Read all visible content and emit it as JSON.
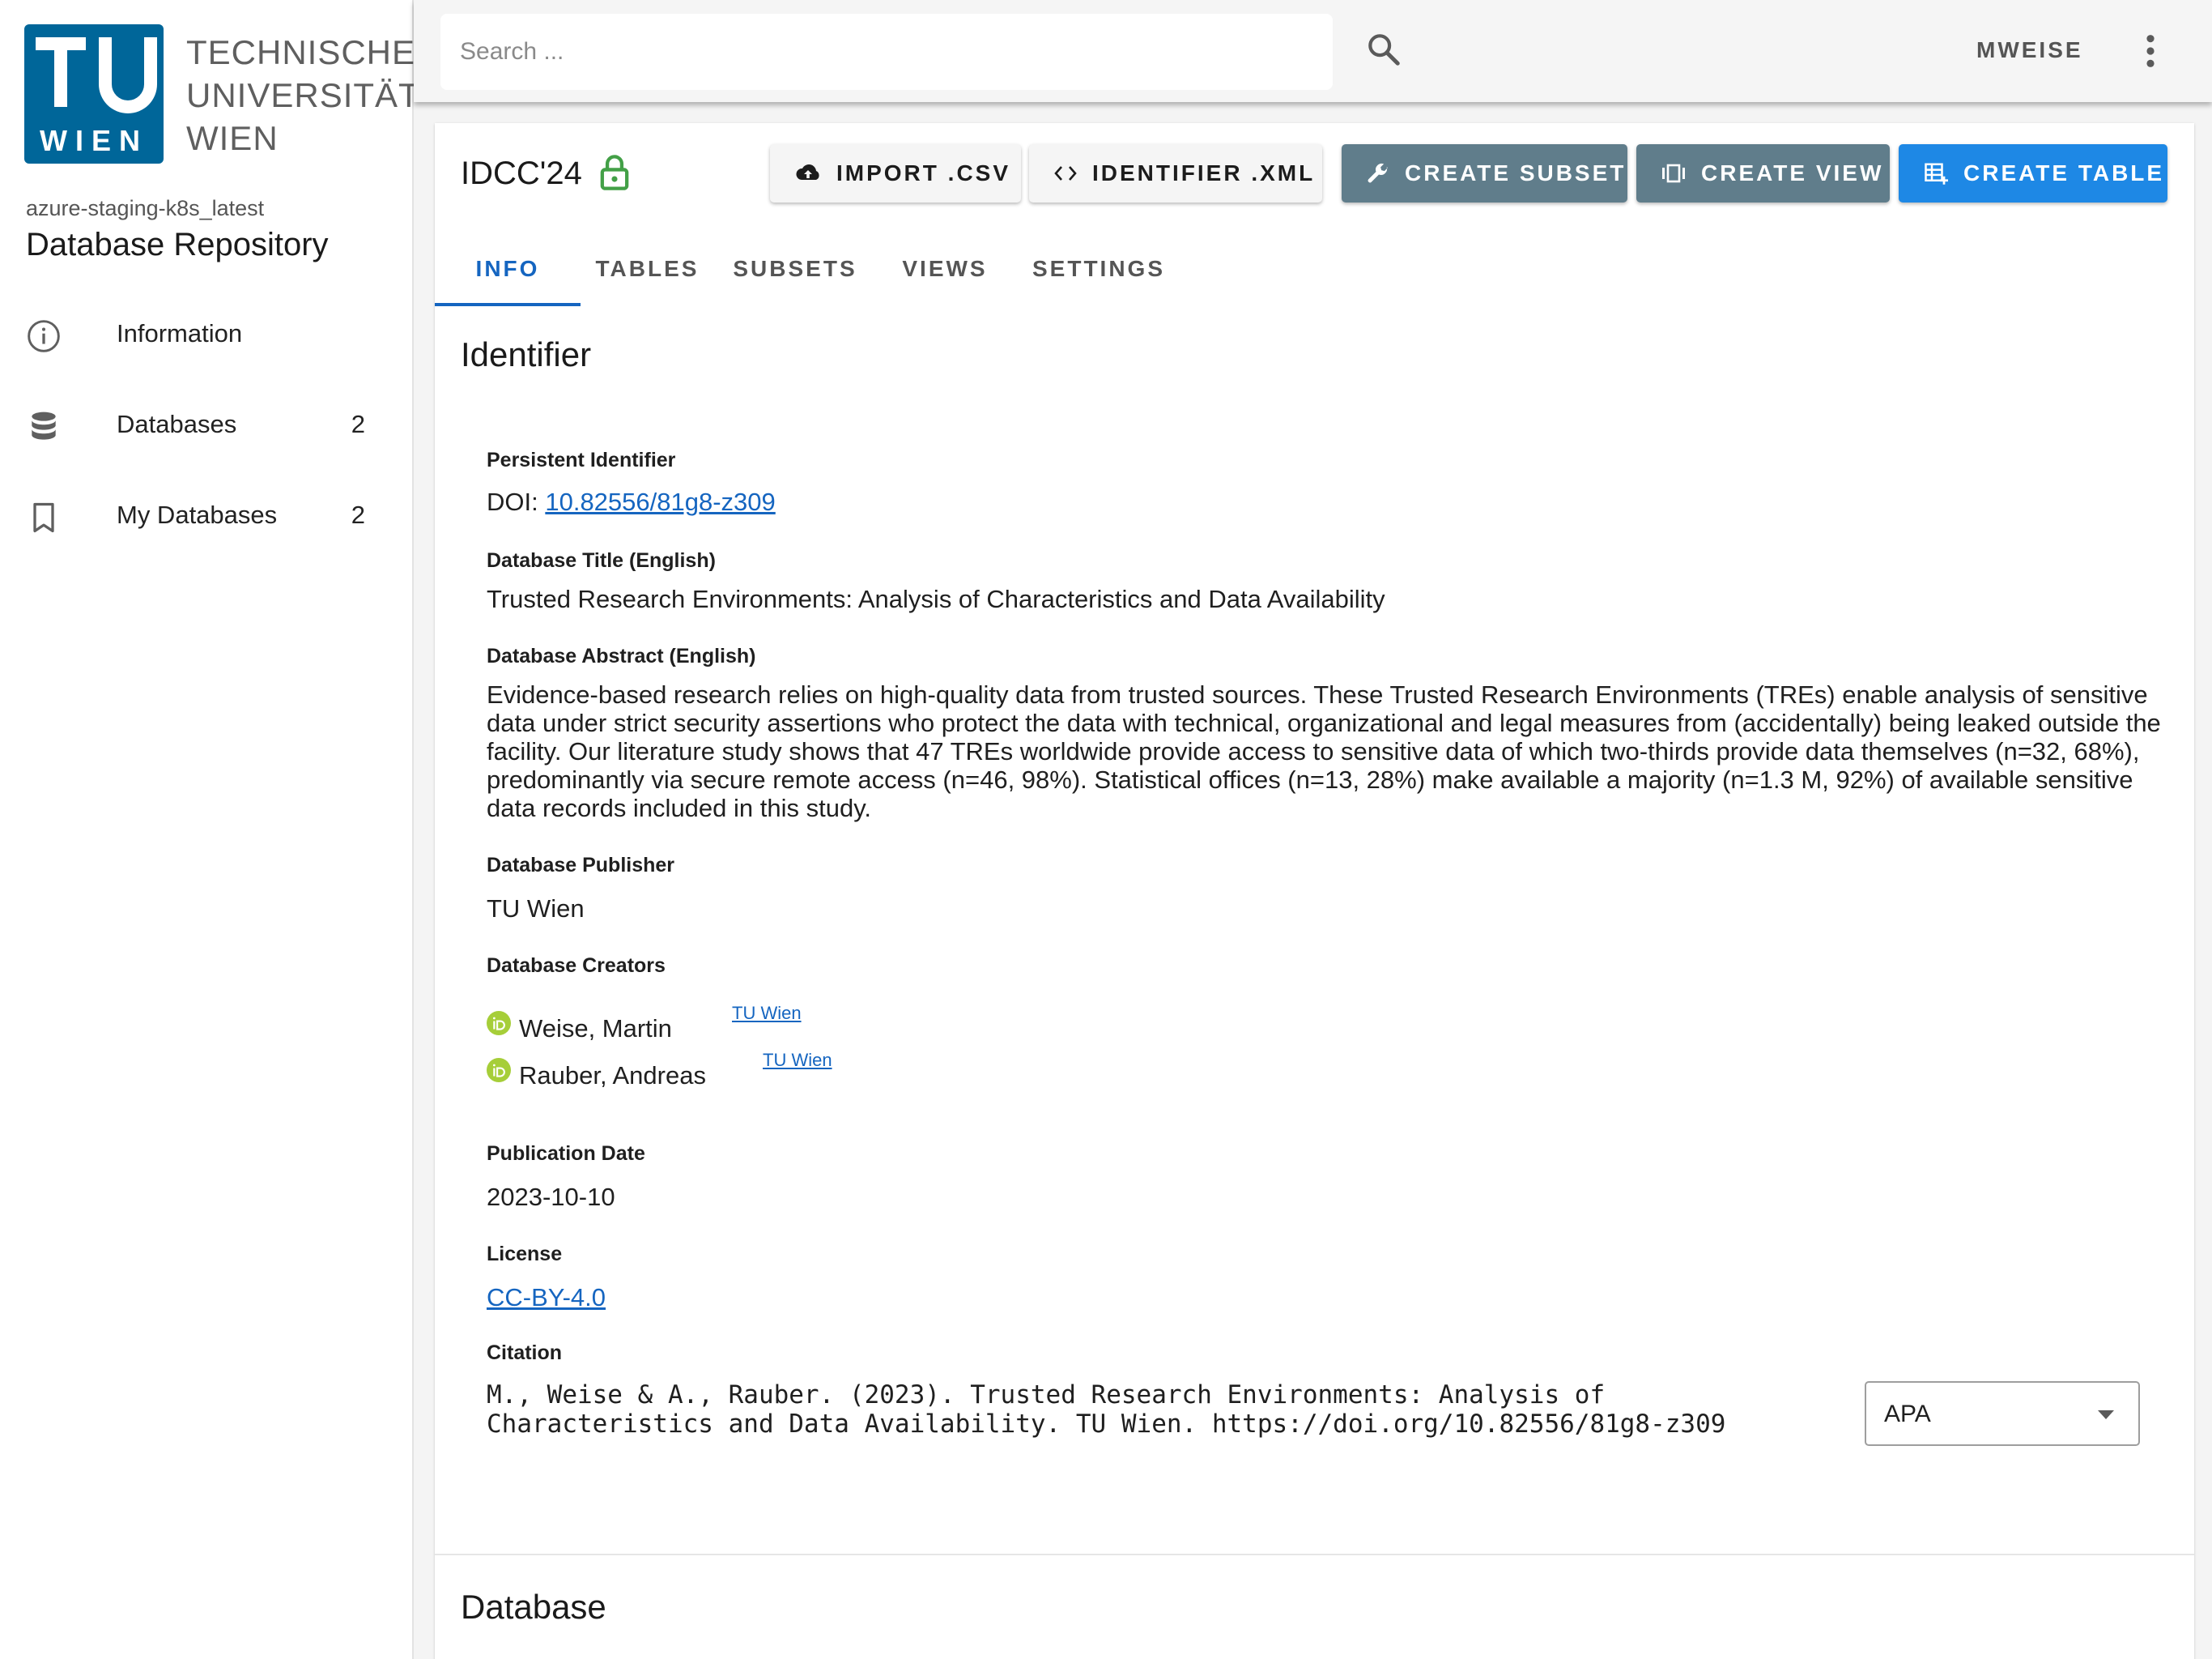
{
  "sidebar": {
    "logo": {
      "line1": "TECHNISCHE",
      "line2": "UNIVERSITÄT",
      "line3": "WIEN",
      "mark_text": "TU WIEN",
      "mark_color": "#006699"
    },
    "environment": "azure-staging-k8s_latest",
    "app_title": "Database Repository",
    "items": [
      {
        "label": "Information",
        "icon": "info-circle-icon",
        "count": ""
      },
      {
        "label": "Databases",
        "icon": "database-icon",
        "count": "2"
      },
      {
        "label": "My Databases",
        "icon": "bookmark-icon",
        "count": "2"
      }
    ]
  },
  "topbar": {
    "search_placeholder": "Search ...",
    "search_value": "",
    "user_label": "MWEISE"
  },
  "database": {
    "title": "IDCC'24",
    "access_icon": "lock-open-icon",
    "accent_color": "#1e88e5",
    "actions": {
      "import_csv": "IMPORT .CSV",
      "identifier_xml": "IDENTIFIER .XML",
      "create_subset": "CREATE SUBSET",
      "create_view": "CREATE VIEW",
      "create_table": "CREATE TABLE"
    },
    "tabs": [
      "INFO",
      "TABLES",
      "SUBSETS",
      "VIEWS",
      "SETTINGS"
    ],
    "active_tab": "INFO"
  },
  "identifier": {
    "section_title": "Identifier",
    "persistent_identifier": {
      "label": "Persistent Identifier",
      "prefix": "DOI: ",
      "value": "10.82556/81g8-z309"
    },
    "title": {
      "label": "Database Title (English)",
      "value": "Trusted Research Environments: Analysis of Characteristics and Data Availability"
    },
    "abstract": {
      "label": "Database Abstract (English)",
      "value": "Evidence-based research relies on high-quality data from trusted sources. These Trusted Research Environments (TREs) enable analysis of sensitive data under strict security assertions who protect the data with technical, organizational and legal measures from (accidentally) being leaked outside the facility. Our literature study shows that 47 TREs worldwide provide access to sensitive data of which two-thirds provide data themselves (n=32, 68%), predominantly via secure remote access (n=46, 98%). Statistical offices (n=13, 28%) make available a majority (n=1.3 M, 92%) of available sensitive data records included in this study."
    },
    "publisher": {
      "label": "Database Publisher",
      "value": "TU Wien"
    },
    "creators": {
      "label": "Database Creators",
      "items": [
        {
          "name": "Weise, Martin",
          "affiliation": "TU Wien"
        },
        {
          "name": "Rauber, Andreas",
          "affiliation": "TU Wien"
        }
      ]
    },
    "publication_date": {
      "label": "Publication Date",
      "value": "2023-10-10"
    },
    "license": {
      "label": "License",
      "value": "CC-BY-4.0"
    },
    "citation": {
      "label": "Citation",
      "value": "M., Weise & A., Rauber. (2023). Trusted Research Environments: Analysis of Characteristics and Data Availability. TU Wien. https://doi.org/10.82556/81g8-z309",
      "style": "APA"
    }
  },
  "database_section": {
    "title": "Database"
  }
}
